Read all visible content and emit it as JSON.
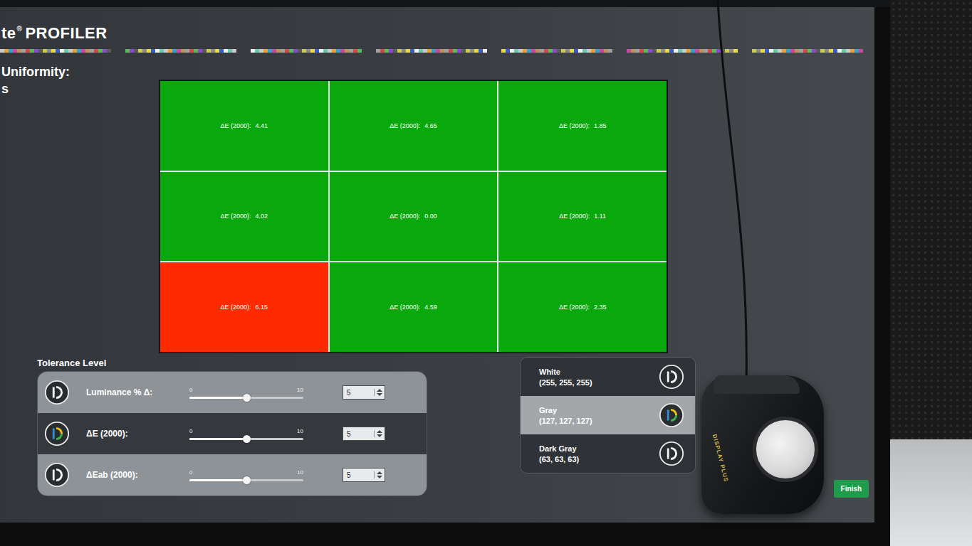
{
  "app": {
    "logo_prefix": "te",
    "logo_mark": "®",
    "logo_name": "PROFILER"
  },
  "page": {
    "title_lines": [
      "Uniformity:",
      "s"
    ]
  },
  "grid": {
    "cells": [
      {
        "label": "ΔE (2000):",
        "value": "4.41",
        "color": "#09a80c"
      },
      {
        "label": "ΔE (2000):",
        "value": "4.65",
        "color": "#09a80c"
      },
      {
        "label": "ΔE (2000):",
        "value": "1.85",
        "color": "#09a80c"
      },
      {
        "label": "ΔE (2000):",
        "value": "4.02",
        "color": "#09a80c"
      },
      {
        "label": "ΔE (2000):",
        "value": "0.00",
        "color": "#09a80c"
      },
      {
        "label": "ΔE (2000):",
        "value": "1.11",
        "color": "#09a80c"
      },
      {
        "label": "ΔE (2000):",
        "value": "6.15",
        "color": "#ff2a00"
      },
      {
        "label": "ΔE (2000):",
        "value": "4.59",
        "color": "#09a80c"
      },
      {
        "label": "ΔE (2000):",
        "value": "2.35",
        "color": "#09a80c"
      }
    ]
  },
  "tolerance": {
    "title": "Tolerance Level",
    "rows": [
      {
        "label": "Luminance % Δ:",
        "min": "0",
        "max": "10",
        "level": 0.5,
        "value": "5",
        "selected": false
      },
      {
        "label": "ΔE (2000):",
        "min": "0",
        "max": "10",
        "level": 0.5,
        "value": "5",
        "selected": true
      },
      {
        "label": "ΔEab (2000):",
        "min": "0",
        "max": "10",
        "level": 0.5,
        "value": "5",
        "selected": false
      }
    ]
  },
  "patterns": [
    {
      "name": "White",
      "value": "(255, 255, 255)",
      "selected": false
    },
    {
      "name": "Gray",
      "value": "(127, 127, 127)",
      "selected": true
    },
    {
      "name": "Dark Gray",
      "value": "(63, 63, 63)",
      "selected": false
    }
  ],
  "buttons": [
    "Finish"
  ],
  "device": {
    "label": "DISPLAY PLUS"
  }
}
